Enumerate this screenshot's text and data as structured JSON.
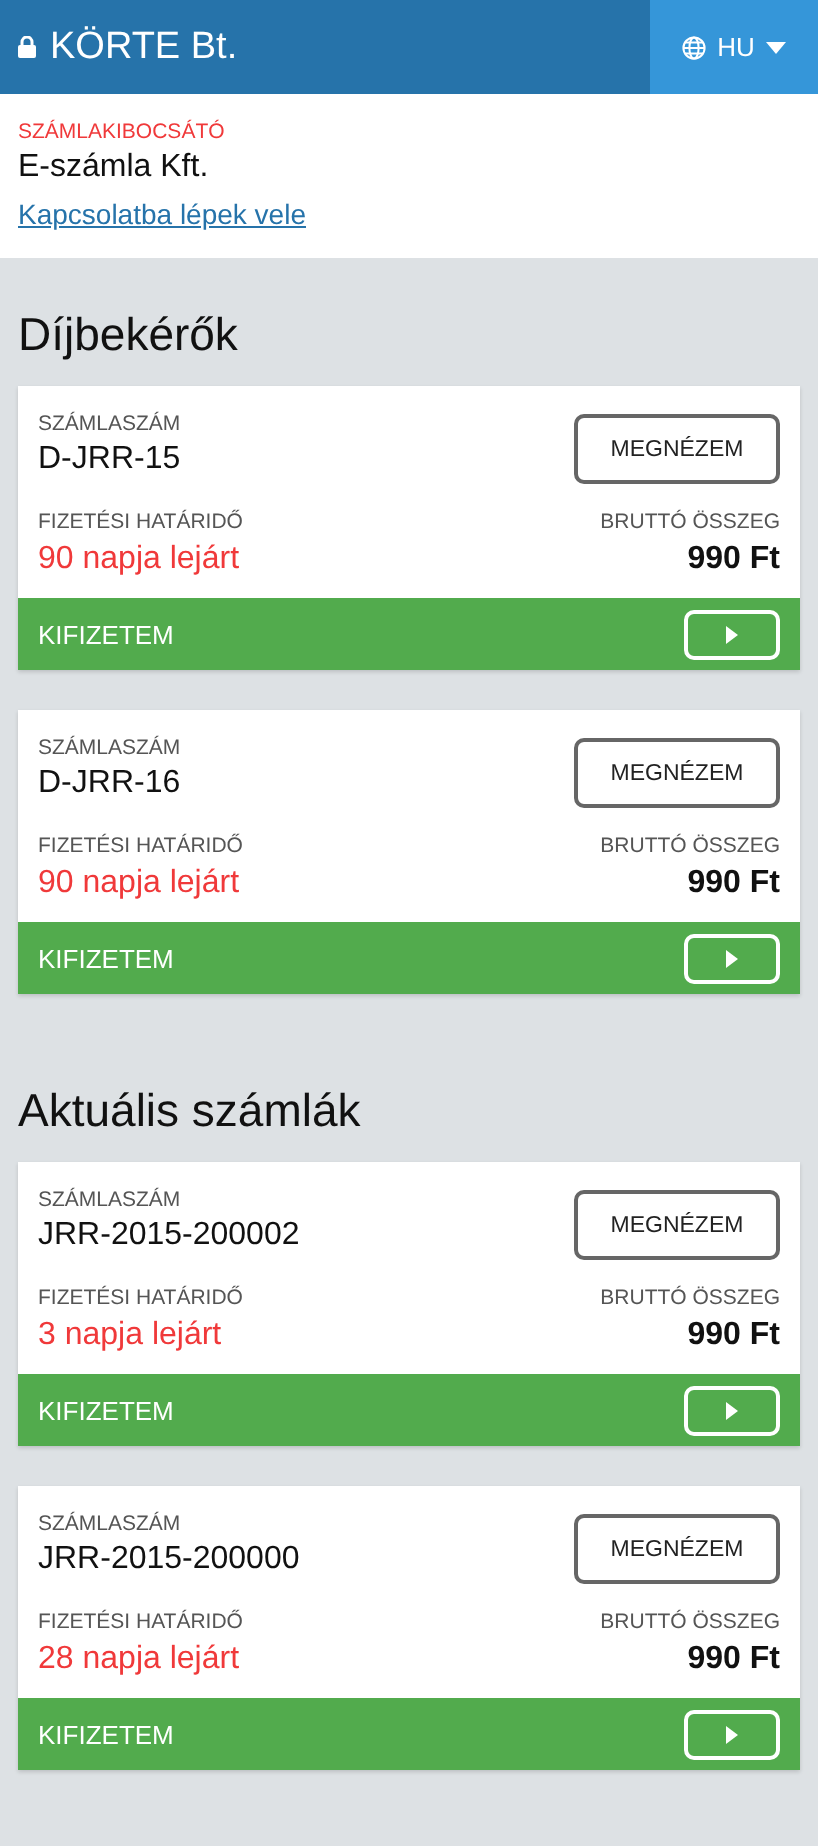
{
  "header": {
    "company": "KÖRTE Bt.",
    "language": "HU"
  },
  "issuer": {
    "label": "SZÁMLAKIBOCSÁTÓ",
    "name": "E-számla Kft.",
    "contact_link": "Kapcsolatba lépek vele"
  },
  "sections": [
    {
      "title": "Díjbekérők",
      "cards": [
        {
          "number_label": "SZÁMLASZÁM",
          "number": "D-JRR-15",
          "view_button": "MEGNÉZEM",
          "due_label": "FIZETÉSI HATÁRIDŐ",
          "due": "90 napja lejárt",
          "overdue": true,
          "amount_label": "BRUTTÓ ÖSSZEG",
          "amount": "990 Ft",
          "pay_label": "KIFIZETEM"
        },
        {
          "number_label": "SZÁMLASZÁM",
          "number": "D-JRR-16",
          "view_button": "MEGNÉZEM",
          "due_label": "FIZETÉSI HATÁRIDŐ",
          "due": "90 napja lejárt",
          "overdue": true,
          "amount_label": "BRUTTÓ ÖSSZEG",
          "amount": "990 Ft",
          "pay_label": "KIFIZETEM"
        }
      ]
    },
    {
      "title": "Aktuális számlák",
      "cards": [
        {
          "number_label": "SZÁMLASZÁM",
          "number": "JRR-2015-200002",
          "view_button": "MEGNÉZEM",
          "due_label": "FIZETÉSI HATÁRIDŐ",
          "due": "3 napja lejárt",
          "overdue": true,
          "amount_label": "BRUTTÓ ÖSSZEG",
          "amount": "990 Ft",
          "pay_label": "KIFIZETEM"
        },
        {
          "number_label": "SZÁMLASZÁM",
          "number": "JRR-2015-200000",
          "view_button": "MEGNÉZEM",
          "due_label": "FIZETÉSI HATÁRIDŐ",
          "due": "28 napja lejárt",
          "overdue": true,
          "amount_label": "BRUTTÓ ÖSSZEG",
          "amount": "990 Ft",
          "pay_label": "KIFIZETEM"
        }
      ]
    }
  ]
}
